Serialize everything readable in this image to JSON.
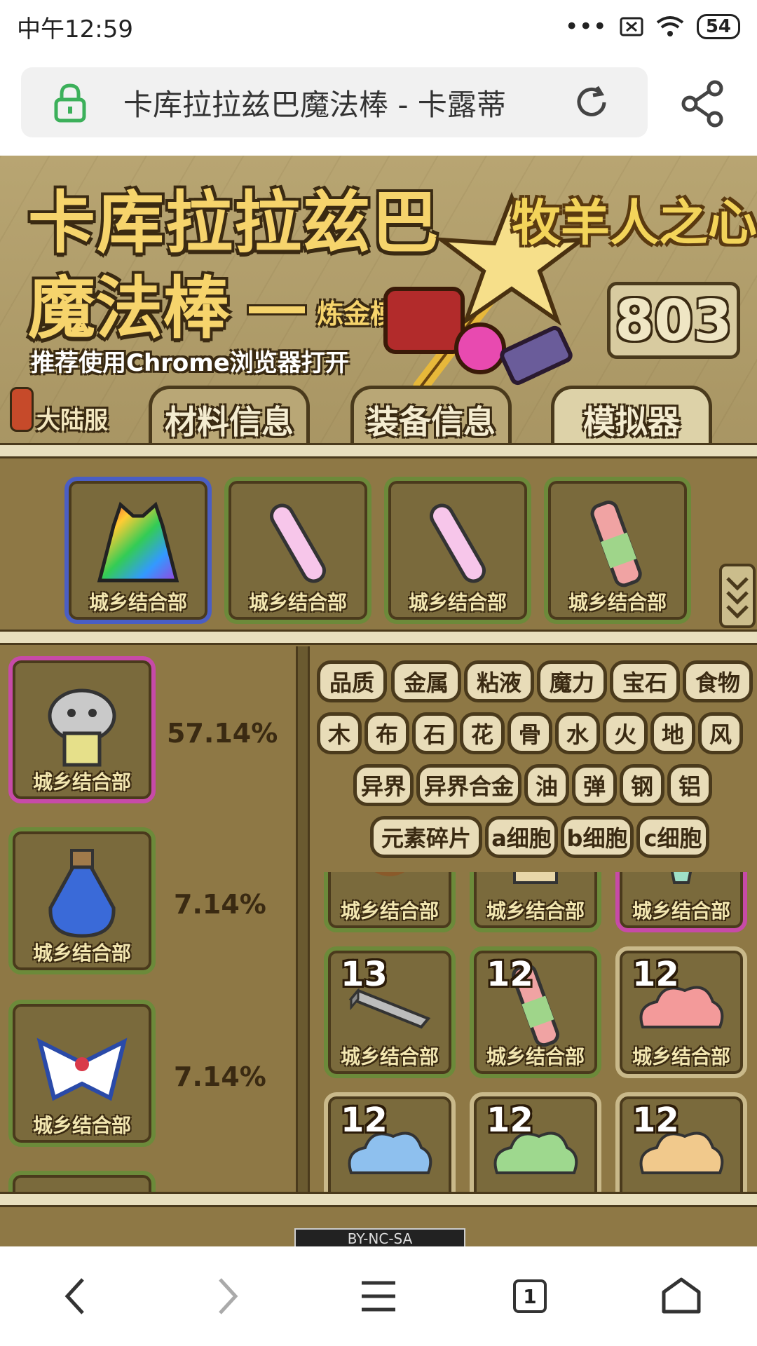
{
  "status": {
    "time": "中午12:59",
    "battery": "54"
  },
  "browser": {
    "url_title": "卡库拉拉兹巴魔法棒 - 卡露蒂",
    "tab_count": "1"
  },
  "banner": {
    "title_line1": "卡库拉拉兹巴",
    "title_line2": "魔法棒",
    "subtitle": "炼金模拟器",
    "recommend": "推荐使用Chrome浏览器打开",
    "logo": "牧羊人之心",
    "count": "803",
    "server": "大陆服"
  },
  "tabs": [
    "材料信息",
    "装备信息",
    "模拟器"
  ],
  "slot_label": "城乡结合部",
  "top_slots": [
    {
      "icon": "rainbow-dress-icon",
      "border": "blue"
    },
    {
      "icon": "pink-potion-tube-icon",
      "border": "green"
    },
    {
      "icon": "pink-potion-tube-icon",
      "border": "green"
    },
    {
      "icon": "green-vial-icon",
      "border": "green"
    }
  ],
  "results": [
    {
      "icon": "armored-cat-icon",
      "border": "pink",
      "percent": "57.14%"
    },
    {
      "icon": "blue-bottle-icon",
      "border": "green",
      "percent": "7.14%"
    },
    {
      "icon": "sailor-collar-icon",
      "border": "green",
      "percent": "7.14%"
    }
  ],
  "filters": {
    "row1": [
      "品质",
      "金属",
      "粘液",
      "魔力",
      "宝石",
      "食物"
    ],
    "row2": [
      "木",
      "布",
      "石",
      "花",
      "骨",
      "水",
      "火",
      "地",
      "风"
    ],
    "row3": [
      "异界",
      "异界合金",
      "油",
      "弹",
      "钢",
      "铝"
    ],
    "row4": [
      "元素碎片",
      "a细胞",
      "b细胞",
      "c细胞"
    ]
  },
  "materials": [
    {
      "icon": "rope-icon",
      "border": "green",
      "count": ""
    },
    {
      "icon": "scroll-icon",
      "border": "green",
      "count": ""
    },
    {
      "icon": "crystal-icon",
      "border": "pink",
      "count": ""
    },
    {
      "icon": "metal-bar-icon",
      "border": "green",
      "count": "13"
    },
    {
      "icon": "green-vial-icon",
      "border": "green",
      "count": "12"
    },
    {
      "icon": "pink-slime-icon",
      "border": "gold",
      "count": "12"
    },
    {
      "icon": "blue-slime-icon",
      "border": "gold",
      "count": "12"
    },
    {
      "icon": "green-slime-icon",
      "border": "gold",
      "count": "12"
    },
    {
      "icon": "orange-slime-icon",
      "border": "gold",
      "count": "12"
    }
  ],
  "license": "BY-NC-SA"
}
